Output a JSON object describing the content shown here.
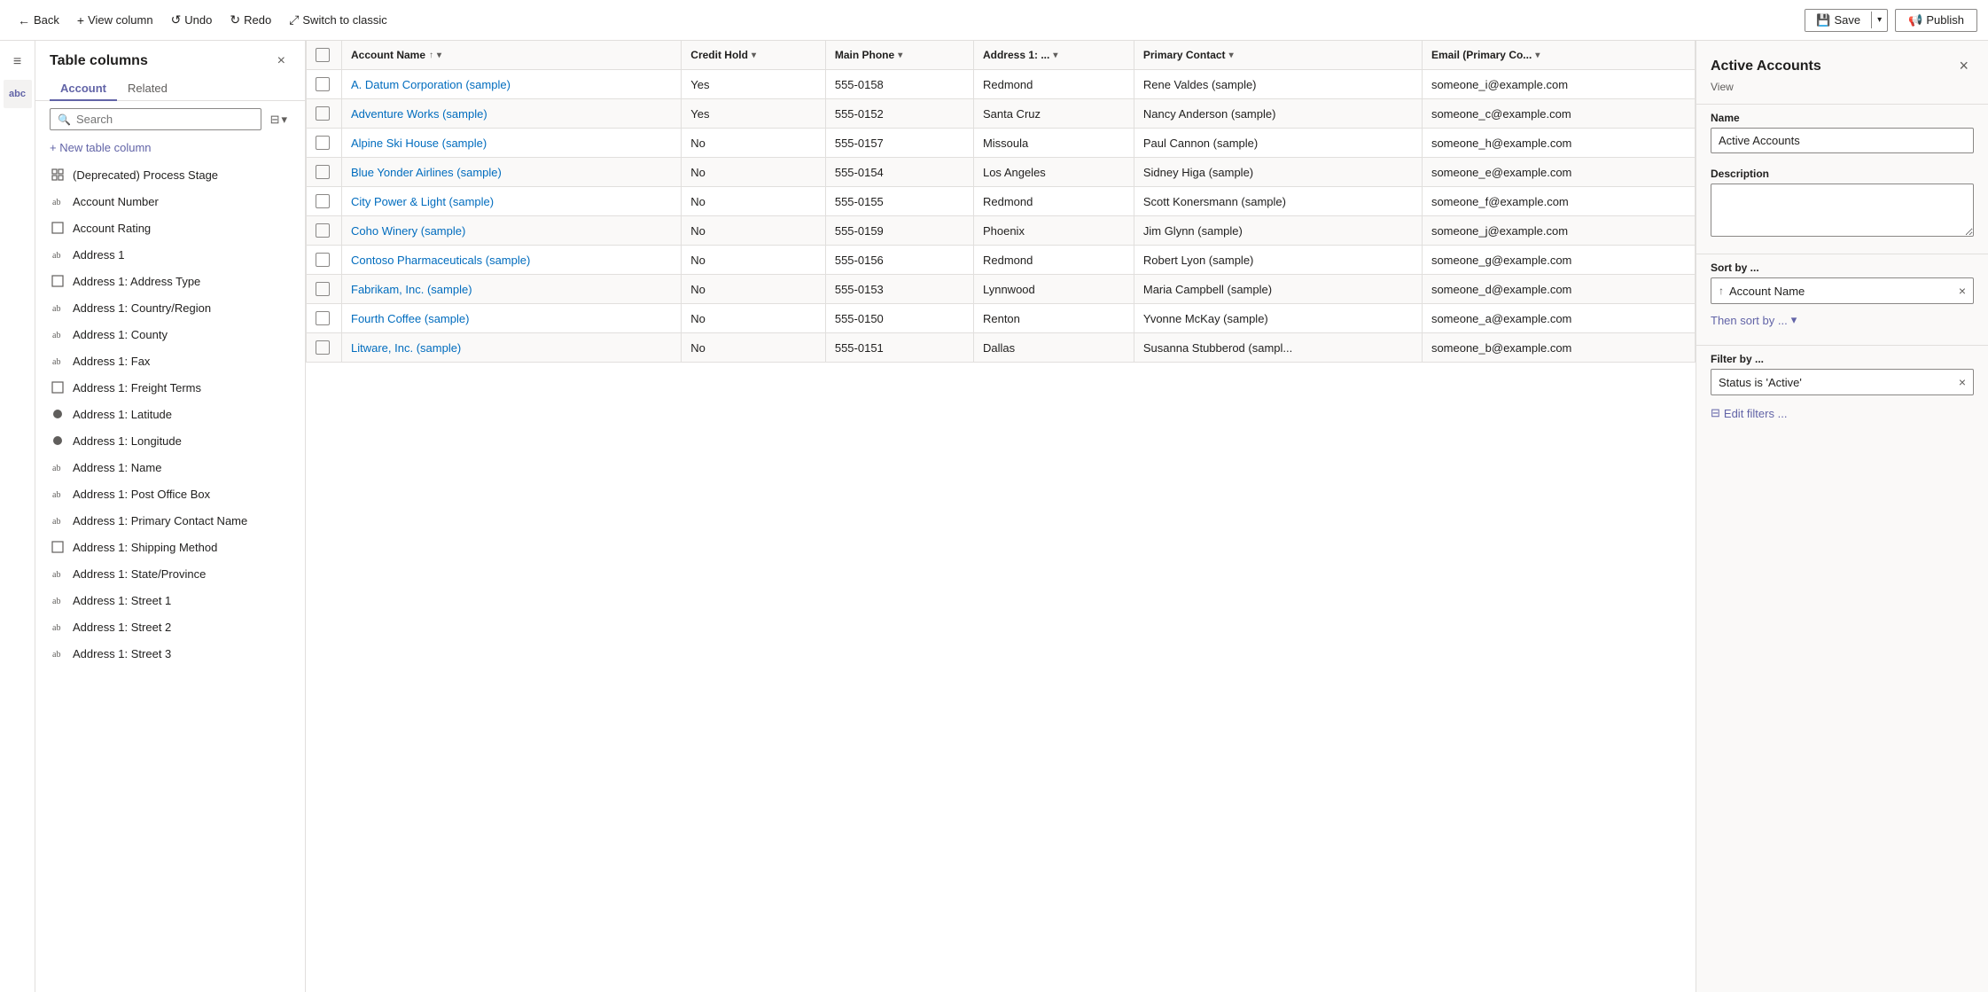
{
  "toolbar": {
    "back_label": "Back",
    "view_column_label": "View column",
    "undo_label": "Undo",
    "redo_label": "Redo",
    "switch_label": "Switch to classic",
    "save_label": "Save",
    "publish_label": "Publish"
  },
  "columns_panel": {
    "title": "Table columns",
    "close_label": "×",
    "tabs": [
      {
        "id": "account",
        "label": "Account",
        "active": true
      },
      {
        "id": "related",
        "label": "Related",
        "active": false
      }
    ],
    "search_placeholder": "Search",
    "new_column_label": "+ New table column",
    "columns": [
      {
        "id": "deprecated-process-stage",
        "label": "(Deprecated) Process Stage",
        "icon": "grid"
      },
      {
        "id": "account-number",
        "label": "Account Number",
        "icon": "text"
      },
      {
        "id": "account-rating",
        "label": "Account Rating",
        "icon": "box"
      },
      {
        "id": "address-1",
        "label": "Address 1",
        "icon": "text"
      },
      {
        "id": "address-1-type",
        "label": "Address 1: Address Type",
        "icon": "box"
      },
      {
        "id": "address-1-country",
        "label": "Address 1: Country/Region",
        "icon": "text"
      },
      {
        "id": "address-1-county",
        "label": "Address 1: County",
        "icon": "text"
      },
      {
        "id": "address-1-fax",
        "label": "Address 1: Fax",
        "icon": "text"
      },
      {
        "id": "address-1-freight",
        "label": "Address 1: Freight Terms",
        "icon": "box"
      },
      {
        "id": "address-1-latitude",
        "label": "Address 1: Latitude",
        "icon": "circle"
      },
      {
        "id": "address-1-longitude",
        "label": "Address 1: Longitude",
        "icon": "circle"
      },
      {
        "id": "address-1-name",
        "label": "Address 1: Name",
        "icon": "text"
      },
      {
        "id": "address-1-pobox",
        "label": "Address 1: Post Office Box",
        "icon": "text"
      },
      {
        "id": "address-1-primary-contact",
        "label": "Address 1: Primary Contact Name",
        "icon": "text"
      },
      {
        "id": "address-1-shipping",
        "label": "Address 1: Shipping Method",
        "icon": "box"
      },
      {
        "id": "address-1-state",
        "label": "Address 1: State/Province",
        "icon": "text"
      },
      {
        "id": "address-1-street1",
        "label": "Address 1: Street 1",
        "icon": "text"
      },
      {
        "id": "address-1-street2",
        "label": "Address 1: Street 2",
        "icon": "text"
      },
      {
        "id": "address-1-street3",
        "label": "Address 1: Street 3",
        "icon": "text"
      }
    ]
  },
  "grid": {
    "columns": [
      {
        "id": "account-name",
        "label": "Account Name",
        "sortable": true,
        "has_up": true
      },
      {
        "id": "credit-hold",
        "label": "Credit Hold",
        "sortable": true
      },
      {
        "id": "main-phone",
        "label": "Main Phone",
        "sortable": true
      },
      {
        "id": "address-1",
        "label": "Address 1: ...",
        "sortable": true
      },
      {
        "id": "primary-contact",
        "label": "Primary Contact",
        "sortable": true
      },
      {
        "id": "email-primary",
        "label": "Email (Primary Co...",
        "sortable": true
      }
    ],
    "rows": [
      {
        "account_name": "A. Datum Corporation (sample)",
        "credit_hold": "Yes",
        "main_phone": "555-0158",
        "address": "Redmond",
        "primary_contact": "Rene Valdes (sample)",
        "email": "someone_i@example.com"
      },
      {
        "account_name": "Adventure Works (sample)",
        "credit_hold": "Yes",
        "main_phone": "555-0152",
        "address": "Santa Cruz",
        "primary_contact": "Nancy Anderson (sample)",
        "email": "someone_c@example.com"
      },
      {
        "account_name": "Alpine Ski House (sample)",
        "credit_hold": "No",
        "main_phone": "555-0157",
        "address": "Missoula",
        "primary_contact": "Paul Cannon (sample)",
        "email": "someone_h@example.com"
      },
      {
        "account_name": "Blue Yonder Airlines (sample)",
        "credit_hold": "No",
        "main_phone": "555-0154",
        "address": "Los Angeles",
        "primary_contact": "Sidney Higa (sample)",
        "email": "someone_e@example.com"
      },
      {
        "account_name": "City Power & Light (sample)",
        "credit_hold": "No",
        "main_phone": "555-0155",
        "address": "Redmond",
        "primary_contact": "Scott Konersmann (sample)",
        "email": "someone_f@example.com"
      },
      {
        "account_name": "Coho Winery (sample)",
        "credit_hold": "No",
        "main_phone": "555-0159",
        "address": "Phoenix",
        "primary_contact": "Jim Glynn (sample)",
        "email": "someone_j@example.com"
      },
      {
        "account_name": "Contoso Pharmaceuticals (sample)",
        "credit_hold": "No",
        "main_phone": "555-0156",
        "address": "Redmond",
        "primary_contact": "Robert Lyon (sample)",
        "email": "someone_g@example.com"
      },
      {
        "account_name": "Fabrikam, Inc. (sample)",
        "credit_hold": "No",
        "main_phone": "555-0153",
        "address": "Lynnwood",
        "primary_contact": "Maria Campbell (sample)",
        "email": "someone_d@example.com"
      },
      {
        "account_name": "Fourth Coffee (sample)",
        "credit_hold": "No",
        "main_phone": "555-0150",
        "address": "Renton",
        "primary_contact": "Yvonne McKay (sample)",
        "email": "someone_a@example.com"
      },
      {
        "account_name": "Litware, Inc. (sample)",
        "credit_hold": "No",
        "main_phone": "555-0151",
        "address": "Dallas",
        "primary_contact": "Susanna Stubberod (sampl...",
        "email": "someone_b@example.com"
      }
    ]
  },
  "right_panel": {
    "title": "Active Accounts",
    "close_label": "×",
    "subtitle": "View",
    "name_label": "Name",
    "name_value": "Active Accounts",
    "description_label": "Description",
    "description_placeholder": "",
    "sort_label": "Sort by ...",
    "sort_field": "Account Name",
    "then_sort_label": "Then sort by ...",
    "filter_label": "Filter by ...",
    "filter_value": "Status is 'Active'",
    "edit_filters_label": "Edit filters ..."
  },
  "icons": {
    "back": "←",
    "plus": "+",
    "undo": "↺",
    "redo": "↻",
    "switch": "⤢",
    "save": "💾",
    "publish": "📢",
    "menu": "≡",
    "search": "🔍",
    "filter": "⊟",
    "filter_chevron": "▾",
    "sort_up": "↑",
    "sort_down": "↓",
    "chevron_down": "▾",
    "close": "×",
    "remove": "×",
    "asc": "↑"
  }
}
